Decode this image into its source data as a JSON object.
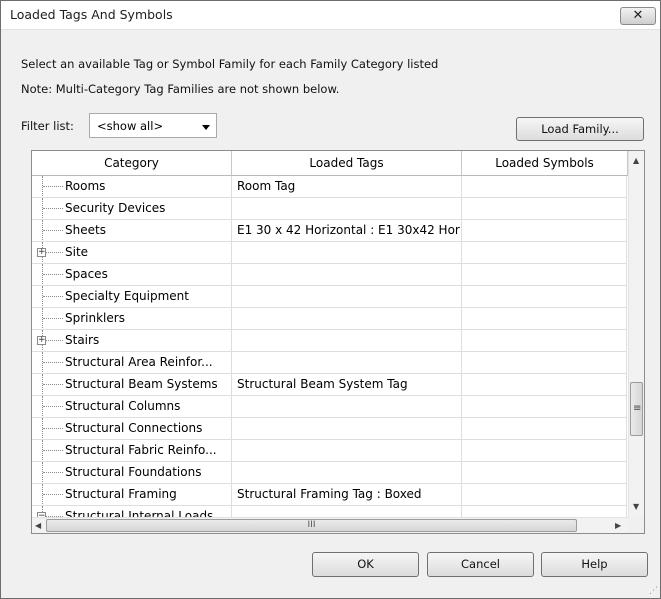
{
  "window": {
    "title": "Loaded Tags And Symbols",
    "close_glyph": "✕"
  },
  "intro": {
    "line1": "Select an available Tag or Symbol Family for each Family Category listed",
    "line2": "Note: Multi-Category Tag Families are not shown below."
  },
  "filter": {
    "label": "Filter list:",
    "value": "<show all>"
  },
  "buttons": {
    "load_family": "Load Family...",
    "ok": "OK",
    "cancel": "Cancel",
    "help": "Help"
  },
  "table": {
    "columns": [
      "Category",
      "Loaded Tags",
      "Loaded Symbols"
    ],
    "rows": [
      {
        "category": "Rooms",
        "tags": "Room Tag",
        "symbols": "",
        "expander": ""
      },
      {
        "category": "Security Devices",
        "tags": "",
        "symbols": "",
        "expander": ""
      },
      {
        "category": "Sheets",
        "tags": "E1 30 x 42 Horizontal : E1 30x42 Hor",
        "symbols": "",
        "expander": ""
      },
      {
        "category": "Site",
        "tags": "",
        "symbols": "",
        "expander": "+"
      },
      {
        "category": "Spaces",
        "tags": "",
        "symbols": "",
        "expander": ""
      },
      {
        "category": "Specialty Equipment",
        "tags": "",
        "symbols": "",
        "expander": ""
      },
      {
        "category": "Sprinklers",
        "tags": "",
        "symbols": "",
        "expander": ""
      },
      {
        "category": "Stairs",
        "tags": "",
        "symbols": "",
        "expander": "+"
      },
      {
        "category": "Structural Area Reinfor...",
        "tags": "",
        "symbols": "",
        "expander": ""
      },
      {
        "category": "Structural Beam Systems",
        "tags": "Structural Beam System Tag",
        "symbols": "",
        "expander": ""
      },
      {
        "category": "Structural Columns",
        "tags": "",
        "symbols": "",
        "expander": ""
      },
      {
        "category": "Structural Connections",
        "tags": "",
        "symbols": "",
        "expander": ""
      },
      {
        "category": "Structural Fabric Reinfo...",
        "tags": "",
        "symbols": "",
        "expander": ""
      },
      {
        "category": "Structural Foundations",
        "tags": "",
        "symbols": "",
        "expander": ""
      },
      {
        "category": "Structural Framing",
        "tags": "Structural Framing Tag : Boxed",
        "symbols": "",
        "expander": ""
      },
      {
        "category": "Structural Internal Loads",
        "tags": "",
        "symbols": "",
        "expander": "−"
      }
    ]
  },
  "scrollbar": {
    "thumb_glyph": "≡",
    "hthumb_glyph": "III",
    "up": "▲",
    "down": "▼",
    "left": "◀",
    "right": "▶"
  }
}
